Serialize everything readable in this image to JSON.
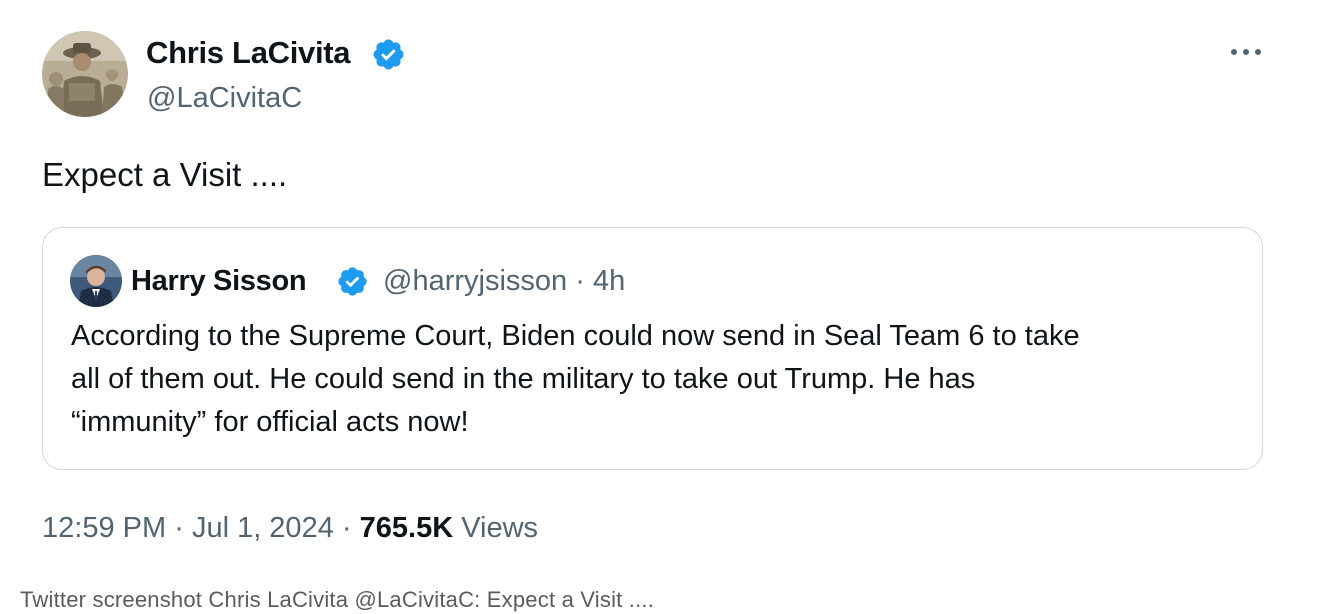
{
  "tweet": {
    "author": {
      "display_name": "Chris LaCivita",
      "handle": "@LaCivitaC",
      "verified": true,
      "avatar_icon": "avatar-photo"
    },
    "more_icon": "more-horizontal-icon",
    "text": "Expect a Visit ....",
    "quoted": {
      "author": {
        "display_name": "Harry Sisson",
        "handle": "@harryjsisson",
        "time": "4h",
        "verified": true
      },
      "lines": [
        "According to the Supreme Court, Biden could now send in Seal Team 6 to take",
        "all of them out. He could send in the military to take out Trump. He has",
        "“immunity” for official acts now!"
      ]
    },
    "meta": {
      "time": "12:59 PM",
      "date": "Jul 1, 2024",
      "views_count": "765.5K",
      "views_label": "Views"
    }
  },
  "caption": "Twitter screenshot Chris LaCivita @LaCivitaC: Expect a Visit ....",
  "colors": {
    "text": "#0f1419",
    "secondary": "#536471",
    "verified": "#1d9bf0",
    "border": "#cfd9de"
  }
}
